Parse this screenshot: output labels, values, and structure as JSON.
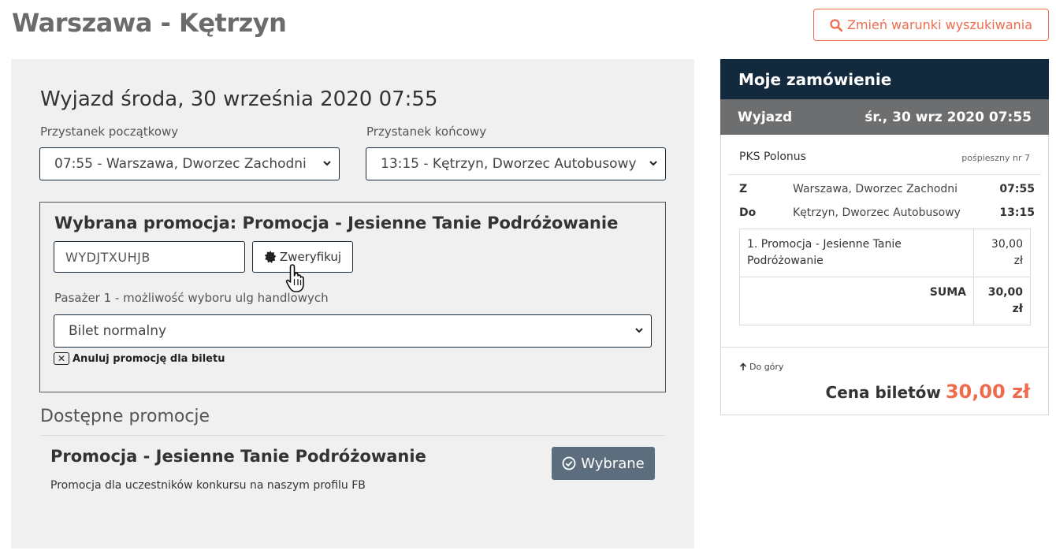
{
  "header": {
    "title": "Warszawa - Kętrzyn",
    "change_search_label": "Zmień warunki wyszukiwania",
    "accent_color": "#ee6b4d"
  },
  "journey": {
    "departure_title": "Wyjazd środa, 30 września 2020 07:55",
    "start_stop_label": "Przystanek początkowy",
    "start_stop_value": "07:55 - Warszawa, Dworzec Zachodni",
    "end_stop_label": "Przystanek końcowy",
    "end_stop_value": "13:15 - Kętrzyn, Dworzec Autobusowy"
  },
  "promo": {
    "selected_title": "Wybrana promocja: Promocja - Jesienne Tanie Podróżowanie",
    "code_value": "WYDJTXUHJB",
    "verify_label": "Zweryfikuj",
    "passenger_label": "Pasażer 1 - możliwość wyboru ulg handlowych",
    "ticket_value": "Bilet normalny",
    "cancel_label": "Anuluj promocję dla biletu"
  },
  "available": {
    "title": "Dostępne promocje",
    "items": [
      {
        "name": "Promocja - Jesienne Tanie Podróżowanie",
        "description": "Promocja dla uczestników konkursu na naszym profilu FB",
        "button_label": "Wybrane"
      }
    ]
  },
  "order": {
    "title": "Moje zamówienie",
    "trip_label": "Wyjazd",
    "trip_date": "śr., 30 wrz 2020 07:55",
    "carrier": "PKS Polonus",
    "train_type": "pośpieszny nr 7",
    "from_code": "Z",
    "from_name": "Warszawa, Dworzec Zachodni",
    "from_time": "07:55",
    "to_code": "Do",
    "to_name": "Kętrzyn, Dworzec Autobusowy",
    "to_time": "13:15",
    "items": [
      {
        "label": "1. Promocja - Jesienne Tanie Podróżowanie",
        "price": "30,00 zł"
      }
    ],
    "sum_label": "SUMA",
    "sum_value": "30,00 zł",
    "back_to_top": "Do góry",
    "total_label": "Cena biletów",
    "total_value": "30,00 zł",
    "header_color": "#13293d",
    "trip_bar_color": "#6d6e70",
    "chosen_button_color": "#5c6e7d"
  }
}
